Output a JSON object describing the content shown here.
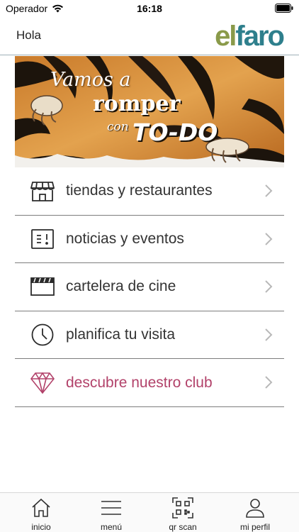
{
  "status_bar": {
    "carrier": "Operador",
    "time": "16:18"
  },
  "header": {
    "greeting": "Hola",
    "logo_el": "el",
    "logo_faro": "faro"
  },
  "banner": {
    "line1": "Vamos a",
    "line2": "romper",
    "line3": "con",
    "line4": "TO-DO"
  },
  "menu": {
    "items": [
      {
        "label": "tiendas y restaurantes",
        "icon": "store-icon"
      },
      {
        "label": "noticias y eventos",
        "icon": "news-icon"
      },
      {
        "label": "cartelera de cine",
        "icon": "clapperboard-icon"
      },
      {
        "label": "planifica tu visita",
        "icon": "clock-icon"
      },
      {
        "label": "descubre nuestro club",
        "icon": "diamond-icon"
      }
    ]
  },
  "tabbar": {
    "tabs": [
      {
        "label": "inicio",
        "icon": "home-icon"
      },
      {
        "label": "menú",
        "icon": "hamburger-icon"
      },
      {
        "label": "qr scan",
        "icon": "qr-icon"
      },
      {
        "label": "mi perfil",
        "icon": "user-icon"
      }
    ]
  },
  "colors": {
    "club_accent": "#b2426a",
    "logo_green": "#8a9a4a",
    "logo_teal": "#2e7f8c"
  }
}
